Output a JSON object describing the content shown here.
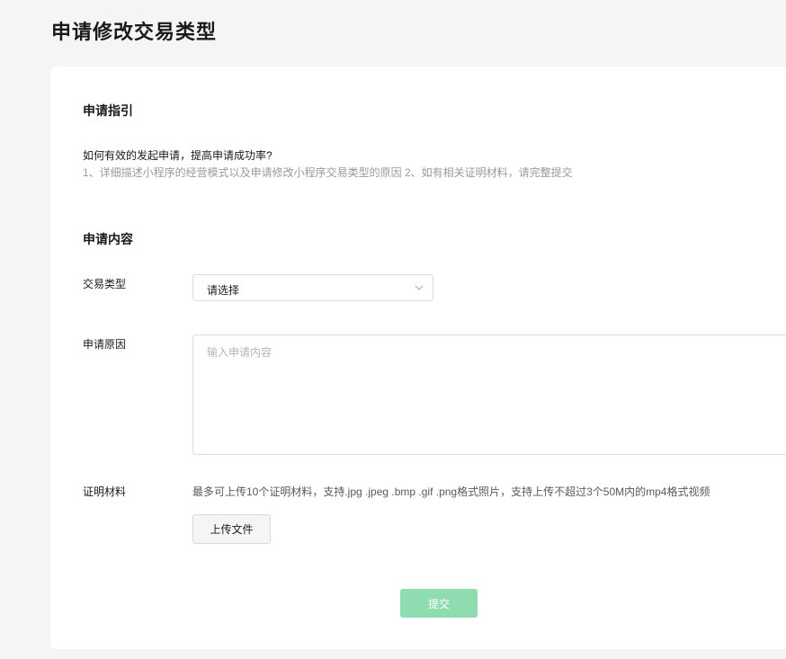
{
  "page": {
    "title": "申请修改交易类型"
  },
  "guide": {
    "title": "申请指引",
    "question": "如何有效的发起申请，提高申请成功率?",
    "tips": "1、详细描述小程序的经营模式以及申请修改小程序交易类型的原因 2、如有相关证明材料，请完整提交"
  },
  "content": {
    "title": "申请内容",
    "trade_type": {
      "label": "交易类型",
      "selected": "请选择"
    },
    "reason": {
      "label": "申请原因",
      "placeholder": "输入申请内容",
      "value": ""
    },
    "materials": {
      "label": "证明材料",
      "hint": "最多可上传10个证明材料，支持.jpg .jpeg .bmp .gif .png格式照片，支持上传不超过3个50M内的mp4格式视频",
      "upload_label": "上传文件"
    },
    "submit_label": "提交"
  },
  "colors": {
    "submit_disabled_bg": "#8fdcb0",
    "page_bg": "#f4f5f7"
  },
  "icons": {
    "select_arrow": "chevron-down-icon"
  }
}
